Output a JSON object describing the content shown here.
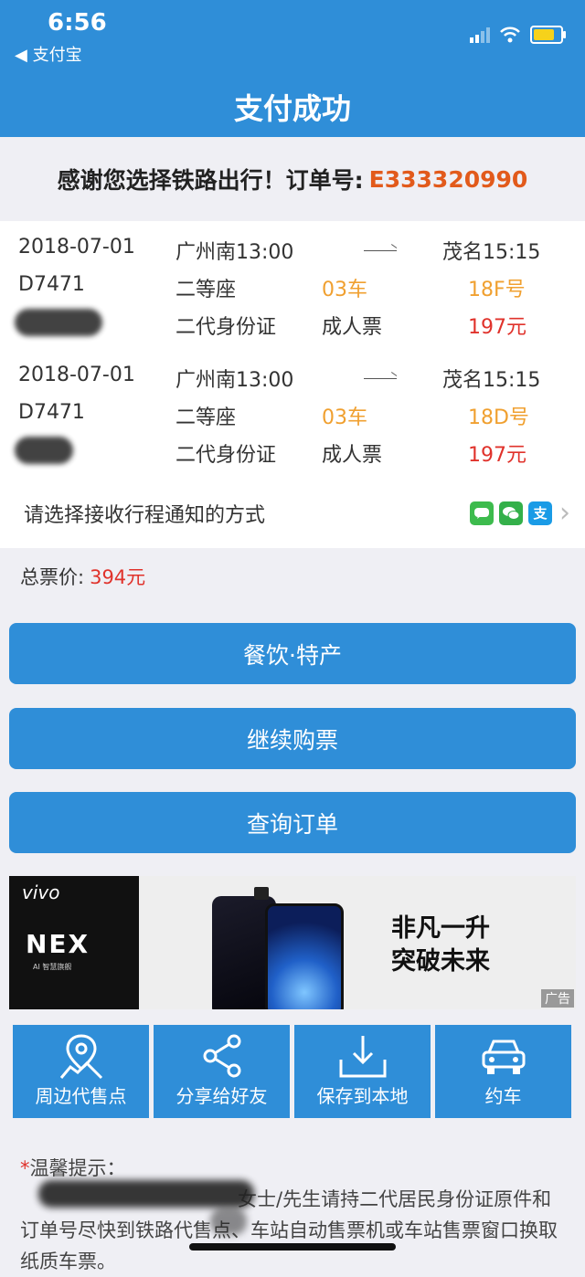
{
  "status_bar": {
    "time": "6:56",
    "back_app": "支付宝"
  },
  "header": {
    "title": "支付成功"
  },
  "thanks": {
    "text": "感谢您选择铁路出行！订单号:",
    "order_no": "E333320990"
  },
  "tickets": [
    {
      "date": "2018-07-01",
      "from": "广州南13:00",
      "to": "茂名15:15",
      "train": "D7471",
      "seat_class": "二等座",
      "car": "03车",
      "seat": "18F号",
      "id_type": "二代身份证",
      "ticket_type": "成人票",
      "price": "197元"
    },
    {
      "date": "2018-07-01",
      "from": "广州南13:00",
      "to": "茂名15:15",
      "train": "D7471",
      "seat_class": "二等座",
      "car": "03车",
      "seat": "18D号",
      "id_type": "二代身份证",
      "ticket_type": "成人票",
      "price": "197元"
    }
  ],
  "notify": {
    "label": "请选择接收行程通知的方式",
    "icons": [
      "sms-icon",
      "wechat-icon",
      "alipay-icon"
    ]
  },
  "total": {
    "label": "总票价:",
    "amount": "394元"
  },
  "buttons": {
    "food": "餐饮·特产",
    "continue": "继续购票",
    "query": "查询订单"
  },
  "ad": {
    "brand": "vivo",
    "product": "NEX",
    "sub": "AI 智慧旗舰",
    "slogan_line1": "非凡一升",
    "slogan_line2": "突破未来",
    "tag": "广告"
  },
  "tiles": [
    {
      "label": "周边代售点",
      "icon": "location-icon"
    },
    {
      "label": "分享给好友",
      "icon": "share-icon"
    },
    {
      "label": "保存到本地",
      "icon": "download-icon"
    },
    {
      "label": "约车",
      "icon": "car-icon"
    }
  ],
  "tips": {
    "title": "温馨提示：",
    "body": "女士/先生请持二代居民身份证原件和订单号尽快到铁路代售点、车站自动售票机或车站售票窗口换取纸质车票。"
  },
  "colors": {
    "primary": "#2f8ed8",
    "order": "#e25a1b",
    "price": "#e0322b",
    "seat": "#f0a030"
  }
}
